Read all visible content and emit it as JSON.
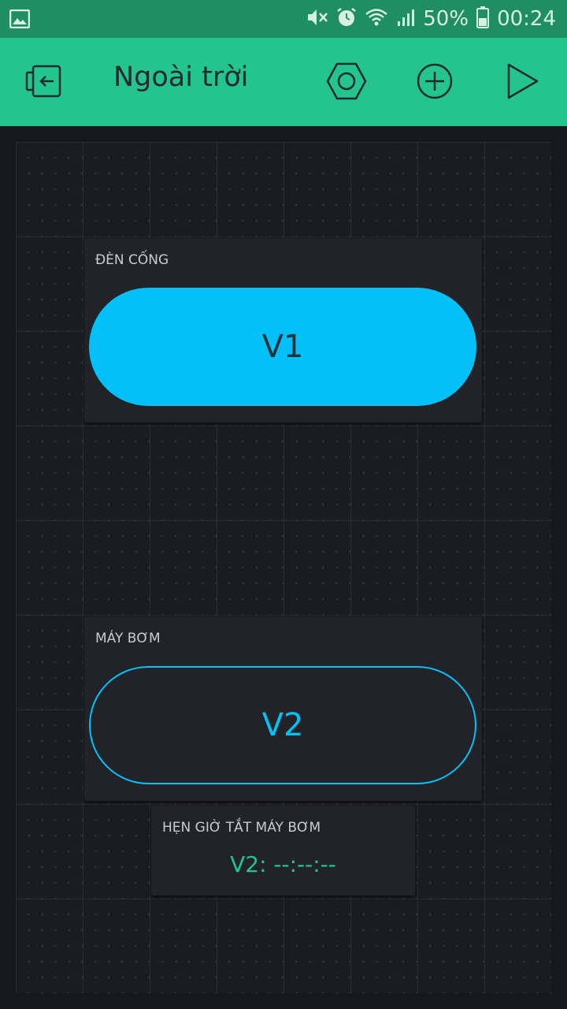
{
  "status_bar": {
    "battery": "50%",
    "time": "00:24",
    "icons": [
      "image-icon",
      "mute-icon",
      "alarm-icon",
      "wifi-icon",
      "signal-icon",
      "battery-icon"
    ]
  },
  "header": {
    "title": "Ngoài trời",
    "icons": [
      "exit-icon",
      "settings-icon",
      "add-icon",
      "play-icon"
    ]
  },
  "widgets": {
    "den_cong": {
      "label": "ĐÈN CỐNG",
      "button_text": "V1",
      "state": "on"
    },
    "may_bom": {
      "label": "MÁY BƠM",
      "button_text": "V2",
      "state": "off"
    },
    "timer": {
      "label": "HẸN GIỜ TẮT MÁY BƠM",
      "value": "V2: --:--:--"
    }
  },
  "colors": {
    "accent_green": "#23c48e",
    "status_green": "#1f8f63",
    "button_blue": "#04c0f8",
    "background": "#17181d",
    "widget_bg": "#212329"
  }
}
